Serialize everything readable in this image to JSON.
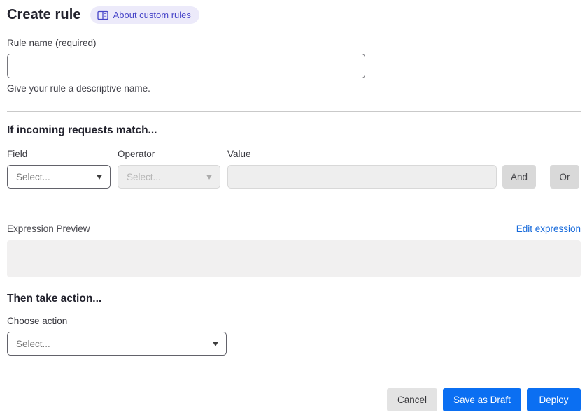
{
  "page": {
    "title": "Create rule",
    "about_link": "About custom rules"
  },
  "rule_name": {
    "label": "Rule name (required)",
    "value": "",
    "helper": "Give your rule a descriptive name."
  },
  "match": {
    "heading": "If incoming requests match...",
    "field_label": "Field",
    "field_value": "Select...",
    "operator_label": "Operator",
    "operator_value": "Select...",
    "value_label": "Value",
    "value_text": "",
    "and_label": "And",
    "or_label": "Or"
  },
  "expression": {
    "label": "Expression Preview",
    "edit_link": "Edit expression",
    "preview_text": ""
  },
  "action": {
    "heading": "Then take action...",
    "choose_label": "Choose action",
    "select_value": "Select..."
  },
  "footer": {
    "cancel": "Cancel",
    "save_as_draft": "Save as Draft",
    "deploy": "Deploy"
  },
  "icons": {
    "about_link_icon": "book-reader-icon",
    "dropdown_caret_icon": "caret-down",
    "caret_glyph": "▾"
  },
  "colors": {
    "primary_button": "#0b6ff2",
    "link": "#1569db",
    "badge_bg": "#eceafa",
    "badge_text": "#4745c8"
  }
}
